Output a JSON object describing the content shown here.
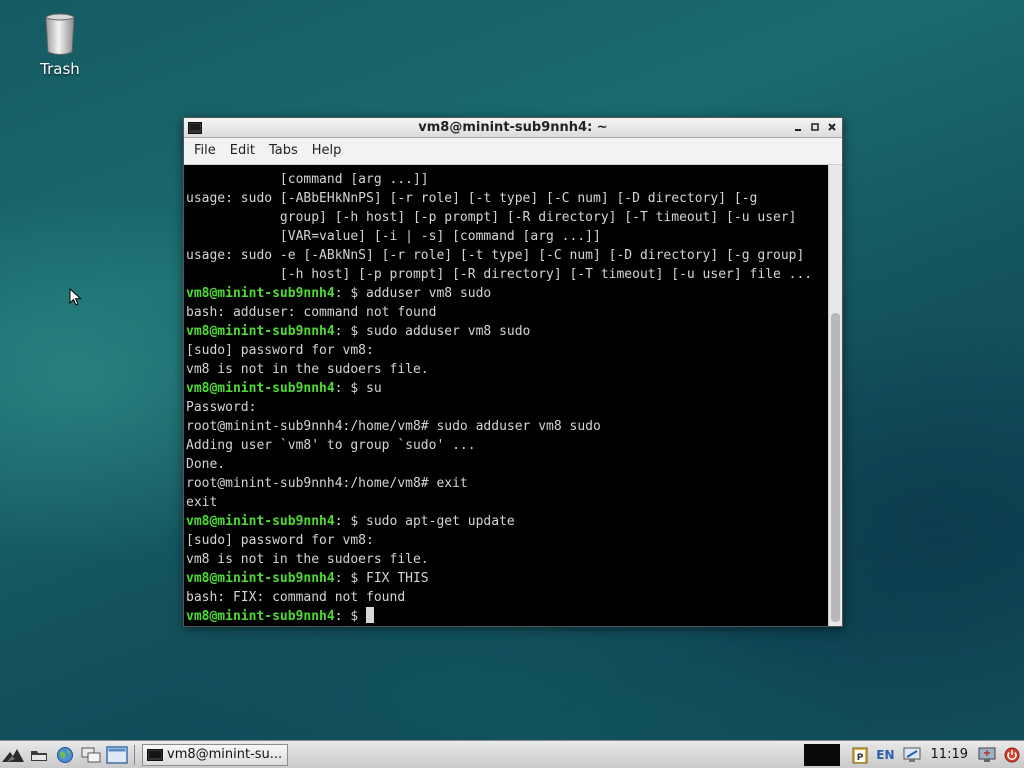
{
  "desktop": {
    "icons": [
      {
        "label": "Trash",
        "icon": "trash-icon"
      }
    ]
  },
  "window": {
    "title": "vm8@minint-sub9nnh4: ~",
    "menu": [
      "File",
      "Edit",
      "Tabs",
      "Help"
    ],
    "lines": [
      {
        "prompt": "",
        "text": "            [command [arg ...]]"
      },
      {
        "prompt": "",
        "text": "usage: sudo [-ABbEHkNnPS] [-r role] [-t type] [-C num] [-D directory] [-g"
      },
      {
        "prompt": "",
        "text": "            group] [-h host] [-p prompt] [-R directory] [-T timeout] [-u user]"
      },
      {
        "prompt": "",
        "text": "            [VAR=value] [-i | -s] [command [arg ...]]"
      },
      {
        "prompt": "",
        "text": "usage: sudo -e [-ABkNnS] [-r role] [-t type] [-C num] [-D directory] [-g group]"
      },
      {
        "prompt": "",
        "text": "            [-h host] [-p prompt] [-R directory] [-T timeout] [-u user] file ..."
      },
      {
        "prompt": "vm8@minint-sub9nnh4",
        "text": ": $ adduser vm8 sudo"
      },
      {
        "prompt": "",
        "text": "bash: adduser: command not found"
      },
      {
        "prompt": "vm8@minint-sub9nnh4",
        "text": ": $ sudo adduser vm8 sudo"
      },
      {
        "prompt": "",
        "text": "[sudo] password for vm8:"
      },
      {
        "prompt": "",
        "text": "vm8 is not in the sudoers file."
      },
      {
        "prompt": "vm8@minint-sub9nnh4",
        "text": ": $ su"
      },
      {
        "prompt": "",
        "text": "Password:"
      },
      {
        "prompt": "",
        "text": "root@minint-sub9nnh4:/home/vm8# sudo adduser vm8 sudo"
      },
      {
        "prompt": "",
        "text": "Adding user `vm8' to group `sudo' ..."
      },
      {
        "prompt": "",
        "text": "Done."
      },
      {
        "prompt": "",
        "text": "root@minint-sub9nnh4:/home/vm8# exit"
      },
      {
        "prompt": "",
        "text": "exit"
      },
      {
        "prompt": "vm8@minint-sub9nnh4",
        "text": ": $ sudo apt-get update"
      },
      {
        "prompt": "",
        "text": "[sudo] password for vm8:"
      },
      {
        "prompt": "",
        "text": "vm8 is not in the sudoers file."
      },
      {
        "prompt": "vm8@minint-sub9nnh4",
        "text": ": $ FIX THIS"
      },
      {
        "prompt": "",
        "text": "bash: FIX: command not found"
      },
      {
        "prompt": "vm8@minint-sub9nnh4",
        "text": ": $ ",
        "cursor": true
      }
    ],
    "scrollbar_position": 0.38
  },
  "taskbar": {
    "launchers": [
      "start-menu-icon",
      "file-manager-icon",
      "browser-icon",
      "window-switch-icon",
      "show-desktop-icon"
    ],
    "task_label": "vm8@minint-su...",
    "tray": {
      "language": "EN",
      "clock": "11:19"
    }
  },
  "colors": {
    "prompt": "#4edb34",
    "terminal_bg": "#000000",
    "terminal_fg": "#d4d4d4",
    "desktop": "#1a6b6f"
  }
}
